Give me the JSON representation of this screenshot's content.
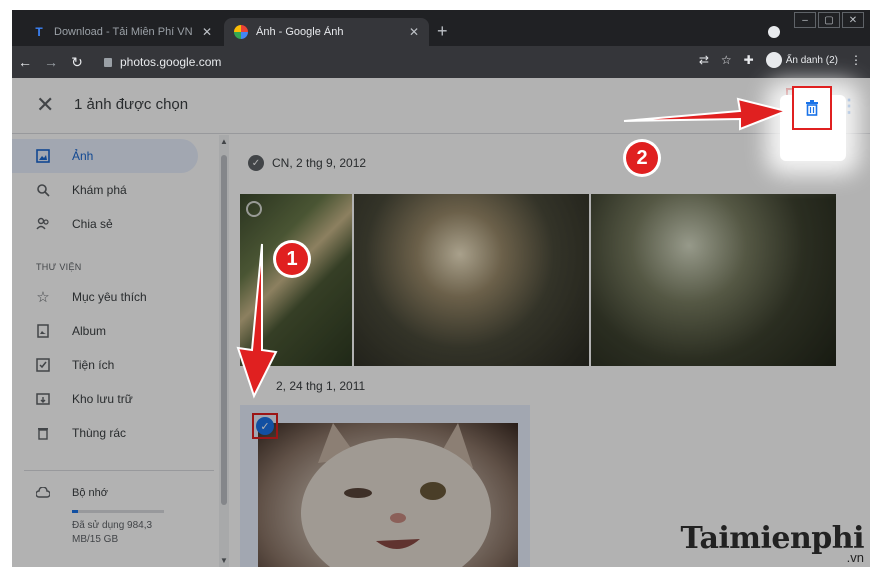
{
  "browser": {
    "tabs": [
      {
        "title": "Download - Tải Miễn Phí VN - Ph",
        "favicon": "T",
        "active": false
      },
      {
        "title": "Ảnh - Google Ảnh",
        "favicon": "pinwheel",
        "active": true
      }
    ],
    "address": "photos.google.com",
    "profile_label": "Ẩn danh (2)"
  },
  "appbar": {
    "selection_title": "1 ảnh được chọn"
  },
  "sidebar": {
    "items": [
      {
        "label": "Ảnh",
        "icon": "photo-icon",
        "active": true
      },
      {
        "label": "Khám phá",
        "icon": "search-icon"
      },
      {
        "label": "Chia sẻ",
        "icon": "people-icon"
      }
    ],
    "section_label": "THƯ VIỆN",
    "library_items": [
      {
        "label": "Mục yêu thích",
        "icon": "star-icon"
      },
      {
        "label": "Album",
        "icon": "album-icon"
      },
      {
        "label": "Tiện ích",
        "icon": "utilities-icon"
      },
      {
        "label": "Kho lưu trữ",
        "icon": "archive-icon"
      },
      {
        "label": "Thùng rác",
        "icon": "trash-icon"
      }
    ],
    "storage": {
      "label": "Bộ nhớ",
      "used_text": "Đã sử dụng 984,3 MB/15 GB",
      "used_fraction": 0.065
    }
  },
  "content": {
    "groups": [
      {
        "date": "CN, 2 thg 9, 2012"
      },
      {
        "date": "2, 24 thg 1, 2011"
      }
    ]
  },
  "annotations": {
    "step1": "1",
    "step2": "2"
  },
  "watermark": {
    "main": "Taimienphi",
    "sub": ".vn"
  },
  "colors": {
    "accent": "#1a73e8",
    "highlight": "#e02020"
  }
}
